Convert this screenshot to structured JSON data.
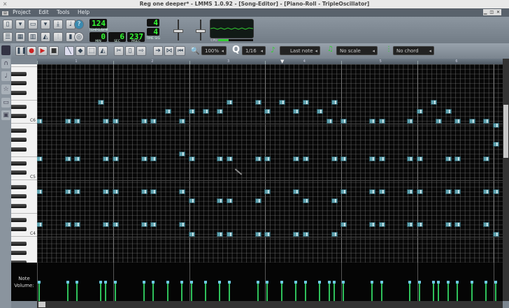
{
  "window": {
    "title": "Reg one deeper* - LMMS 1.0.92 - [Song-Editor] - [Piano-Roll - TripleOscillator]",
    "close": "×"
  },
  "menu": [
    "Project",
    "Edit",
    "Tools",
    "Help"
  ],
  "toolbar": {
    "tempo": "124",
    "tempo_label": "TEMPO/BPM",
    "min": "0",
    "sec": "6",
    "msec": "237",
    "min_label": "MIN",
    "sec_label": "SEC",
    "msec_label": "MSEC",
    "timesig_num": "4",
    "timesig_den": "4",
    "timesig_label": "TIME SIG",
    "cpu_label": "CPU",
    "cpu_load": 0.3
  },
  "pianoroll": {
    "zoom": "100%",
    "quantize": "1/16",
    "note_length": "Last note",
    "scale": "No scale",
    "chord": "No chord",
    "q_label": "Q"
  },
  "ruler": [
    "1",
    "2",
    "3",
    "4",
    "5",
    "6"
  ],
  "keys": {
    "labels": [
      {
        "name": "C6",
        "midi": 84
      },
      {
        "name": "C5",
        "midi": 72
      },
      {
        "name": "C4",
        "midi": 60
      }
    ]
  },
  "volume_label": "Note Volume:",
  "colors": {
    "note": "#5fa3b0",
    "volume": "#2ec05a",
    "grid_bg": "#070707"
  },
  "notes": [
    {
      "pitch": 88,
      "steps": [
        13,
        40,
        46,
        51,
        56,
        62,
        83
      ]
    },
    {
      "pitch": 86,
      "steps": [
        27,
        32,
        35,
        38,
        48,
        54,
        59,
        80,
        86
      ]
    },
    {
      "pitch": 84,
      "steps": [
        0,
        6,
        8,
        14,
        16,
        22,
        24,
        30,
        61,
        64,
        70,
        72,
        78,
        84,
        88,
        91,
        94
      ]
    },
    {
      "pitch": 83,
      "steps": [
        96
      ]
    },
    {
      "pitch": 79,
      "steps": [
        96
      ]
    },
    {
      "pitch": 77,
      "steps": [
        30
      ]
    },
    {
      "pitch": 76,
      "steps": [
        0,
        6,
        8,
        14,
        16,
        22,
        24,
        32,
        38,
        40,
        46,
        48,
        54,
        56,
        62,
        64,
        70,
        72,
        78,
        80,
        86,
        88,
        94
      ]
    },
    {
      "pitch": 69,
      "steps": [
        0,
        6,
        8,
        14,
        16,
        22,
        24,
        30,
        48,
        54,
        64,
        70,
        72,
        78,
        80,
        86,
        88,
        94,
        96
      ]
    },
    {
      "pitch": 67,
      "steps": [
        32,
        38,
        40,
        46,
        56,
        62
      ]
    },
    {
      "pitch": 62,
      "steps": [
        0,
        6,
        8,
        14,
        16,
        22,
        24,
        30,
        64,
        70,
        72,
        78,
        80,
        86,
        88,
        94
      ]
    },
    {
      "pitch": 60,
      "steps": [
        32,
        38,
        40,
        46,
        48,
        54,
        56,
        62,
        96
      ]
    }
  ],
  "note_volume": 0.5
}
